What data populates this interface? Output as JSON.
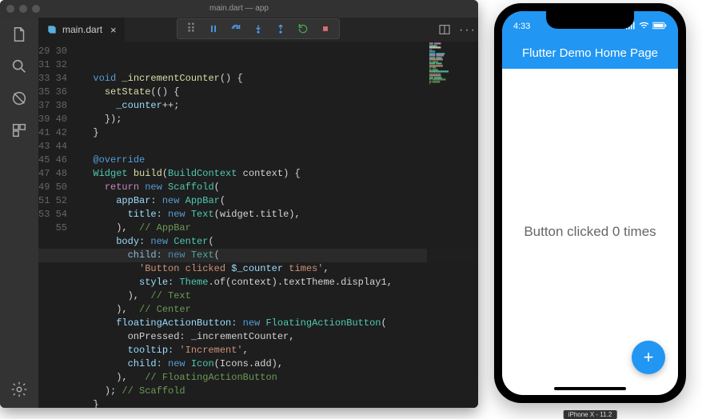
{
  "window": {
    "title": "main.dart — app"
  },
  "tab": {
    "filename": "main.dart",
    "icon": "dart-file-icon"
  },
  "debug": {
    "handle": "··",
    "pause": "pause",
    "stepover": "step-over",
    "stepin": "step-in",
    "stepout": "step-out",
    "restart": "restart",
    "stop": "stop"
  },
  "gutter": {
    "first": 29,
    "last": 55
  },
  "currentLine": 44,
  "code": {
    "l29": "",
    "l30a": "void",
    "l30b": " _incrementCounter",
    "l30c": "() {",
    "l31a": "setState",
    "l31b": "(() {",
    "l32a": "_counter",
    "l32b": "++;",
    "l33": "});",
    "l34": "}",
    "l36": "@override",
    "l37a": "Widget",
    "l37b": " build",
    "l37c": "(",
    "l37d": "BuildContext",
    "l37e": " context) {",
    "l38a": "return",
    "l38b": " new",
    "l38c": " Scaffold",
    "l38d": "(",
    "l39a": "appBar:",
    "l39b": " new",
    "l39c": " AppBar",
    "l39d": "(",
    "l40a": "title:",
    "l40b": " new",
    "l40c": " Text",
    "l40d": "(widget.title),",
    "l41a": "),",
    "l41b": "  // AppBar",
    "l42a": "body:",
    "l42b": " new",
    "l42c": " Center",
    "l42d": "(",
    "l43a": "child:",
    "l43b": " new",
    "l43c": " Text",
    "l43d": "(",
    "l44a": "'Button clicked ",
    "l44b": "$_counter",
    "l44c": " times'",
    "l44d": ",",
    "l45a": "style:",
    "l45b": " Theme",
    "l45c": ".of(context).textTheme.display1,",
    "l46a": "),",
    "l46b": "  // Text",
    "l47a": "),",
    "l47b": "  // Center",
    "l48a": "floatingActionButton:",
    "l48b": " new",
    "l48c": " FloatingActionButton",
    "l48d": "(",
    "l49": "onPressed: _incrementCounter,",
    "l50a": "tooltip:",
    "l50b": " 'Increment'",
    "l50c": ",",
    "l51a": "child:",
    "l51b": " new",
    "l51c": " Icon",
    "l51d": "(Icons.add),",
    "l52a": "),",
    "l52b": "   // FloatingActionButton",
    "l53a": ");",
    "l53b": " // Scaffold",
    "l54": "}",
    "l55": ""
  },
  "phone": {
    "time": "4:33",
    "signal": "signal-icon",
    "wifi": "wifi-icon",
    "battery": "battery-icon",
    "appbar_title": "Flutter Demo Home Page",
    "body_text": "Button clicked 0 times",
    "fab_icon": "+",
    "device_label": "iPhone X - 11.2"
  }
}
